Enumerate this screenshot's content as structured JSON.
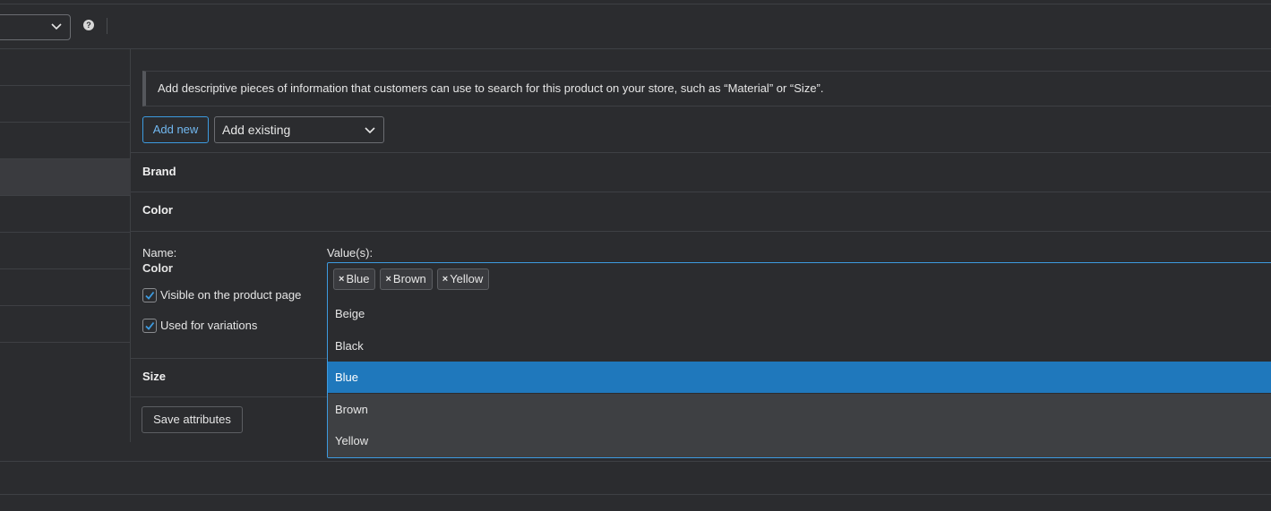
{
  "toolbar": {
    "help_icon": "?"
  },
  "notice": {
    "text": "Add descriptive pieces of information that customers can use to search for this product on your store, such as “Material” or “Size”."
  },
  "actions": {
    "add_new_label": "Add new",
    "add_existing_label": "Add existing"
  },
  "attributes": {
    "brand": {
      "title": "Brand"
    },
    "color": {
      "title": "Color",
      "name_label": "Name:",
      "name_value": "Color",
      "visible_label": "Visible on the product page",
      "variations_label": "Used for variations",
      "values_label": "Value(s):",
      "selected": [
        "Blue",
        "Brown",
        "Yellow"
      ],
      "options": [
        "Beige",
        "Black",
        "Blue",
        "Brown",
        "Yellow"
      ],
      "highlighted_option": "Blue"
    },
    "size": {
      "title": "Size"
    }
  },
  "save_label": "Save attributes",
  "colors": {
    "accent": "#3d9be0",
    "highlight": "#1f78bc",
    "background": "#2b2c2f"
  }
}
